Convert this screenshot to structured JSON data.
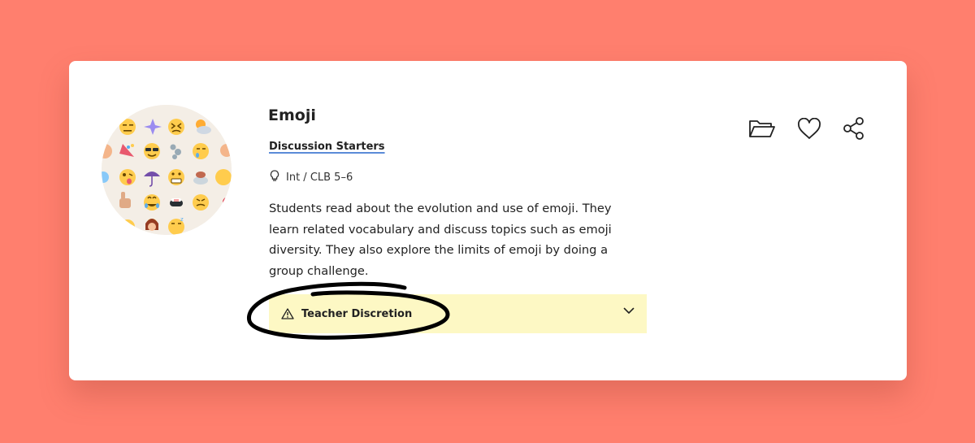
{
  "card": {
    "title": "Emoji",
    "category": "Discussion Starters",
    "level": "Int / CLB 5–6",
    "description": "Students read about the evolution and use of emoji. They learn related vocabulary and discuss topics such as emoji diversity. They also explore the limits of emoji by doing a group challenge.",
    "discretion_label": "Teacher Discretion"
  },
  "icons": {
    "level": "lightbulb-icon",
    "discretion": "warning-icon",
    "expand": "chevron-down-icon",
    "folder": "folder-icon",
    "favorite": "heart-icon",
    "share": "share-icon"
  },
  "colors": {
    "background": "#ff7f6e",
    "card": "#ffffff",
    "discretion_bg": "#fdf8c4",
    "link_underline": "#5b8bd8"
  }
}
